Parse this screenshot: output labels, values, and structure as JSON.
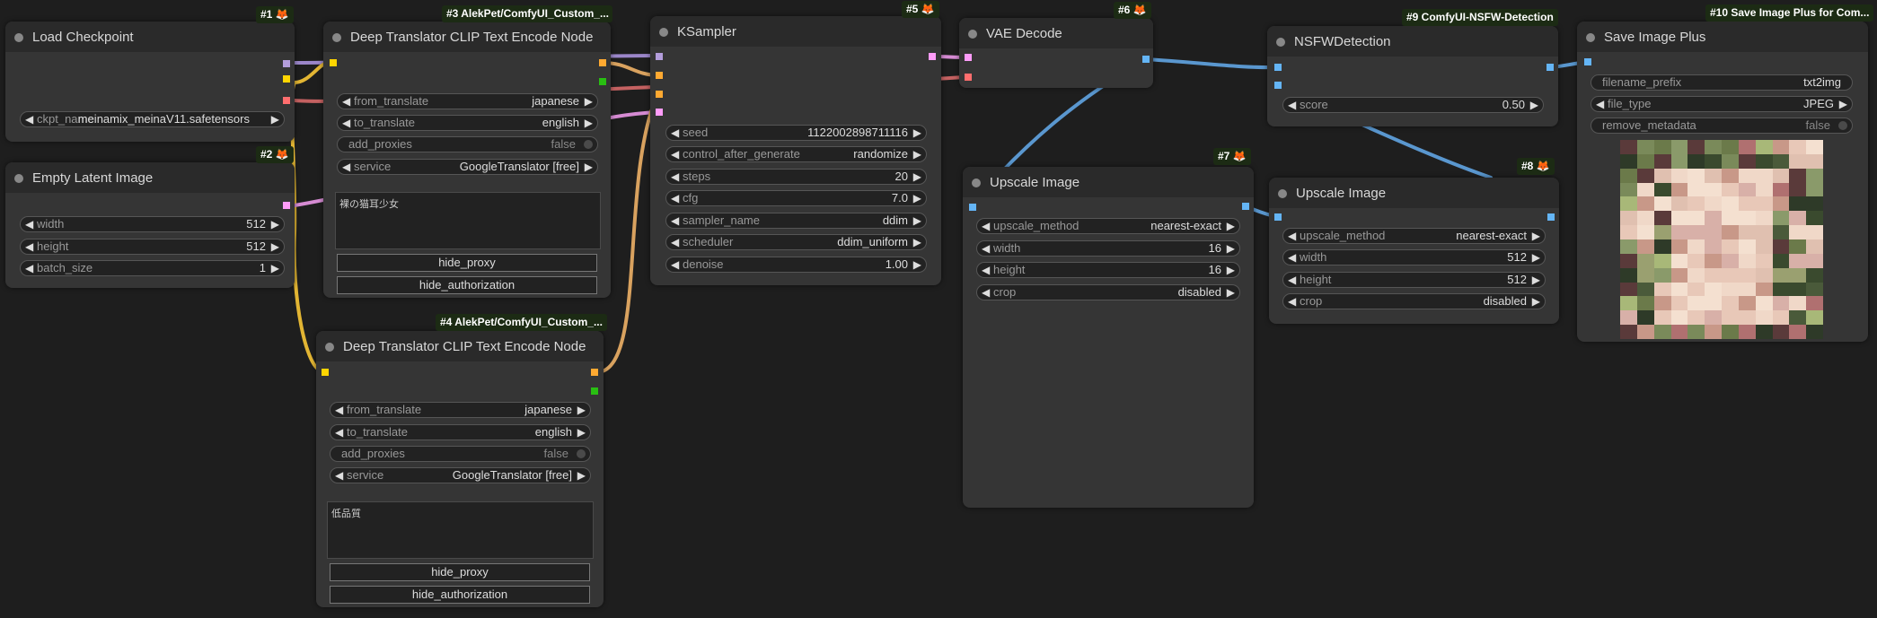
{
  "colors": {
    "clip": "#ffd500",
    "model": "#b39ddb",
    "vae": "#ff6e6e",
    "conditioning": "#ffa931",
    "latent": "#ff9cf9",
    "image": "#64b5f6",
    "int": "#29bf12",
    "link_model": "#9b86c9",
    "link_clip": "#e2b533",
    "link_vae": "#c46161",
    "link_cond": "#d9a25f",
    "link_latent": "#d68bd3",
    "link_image": "#5a97cf"
  },
  "icons": {
    "left": "◀",
    "right": "▶"
  },
  "nodes": {
    "load_checkpoint": {
      "badge": "#1",
      "title": "Load Checkpoint",
      "ckpt_name": {
        "label": "ckpt_name",
        "value": "meinamix_meinaV11.safetensors"
      }
    },
    "empty_latent": {
      "badge": "#2",
      "title": "Empty Latent Image",
      "width": {
        "label": "width",
        "value": "512"
      },
      "height": {
        "label": "height",
        "value": "512"
      },
      "batch_size": {
        "label": "batch_size",
        "value": "1"
      }
    },
    "translator_pos": {
      "badge": "#3 AlekPet/ComfyUI_Custom_...",
      "title": "Deep Translator CLIP Text Encode Node",
      "from_translate": {
        "label": "from_translate",
        "value": "japanese"
      },
      "to_translate": {
        "label": "to_translate",
        "value": "english"
      },
      "add_proxies": {
        "label": "add_proxies",
        "value": "false"
      },
      "service": {
        "label": "service",
        "value": "GoogleTranslator [free]"
      },
      "text": "裸の猫耳少女",
      "hide_proxy": "hide_proxy",
      "hide_authorization": "hide_authorization"
    },
    "translator_neg": {
      "badge": "#4 AlekPet/ComfyUI_Custom_...",
      "title": "Deep Translator CLIP Text Encode Node",
      "from_translate": {
        "label": "from_translate",
        "value": "japanese"
      },
      "to_translate": {
        "label": "to_translate",
        "value": "english"
      },
      "add_proxies": {
        "label": "add_proxies",
        "value": "false"
      },
      "service": {
        "label": "service",
        "value": "GoogleTranslator [free]"
      },
      "text": "低品質",
      "hide_proxy": "hide_proxy",
      "hide_authorization": "hide_authorization"
    },
    "ksampler": {
      "badge": "#5",
      "title": "KSampler",
      "seed": {
        "label": "seed",
        "value": "1122002898711116"
      },
      "control_after_generate": {
        "label": "control_after_generate",
        "value": "randomize"
      },
      "steps": {
        "label": "steps",
        "value": "20"
      },
      "cfg": {
        "label": "cfg",
        "value": "7.0"
      },
      "sampler_name": {
        "label": "sampler_name",
        "value": "ddim"
      },
      "scheduler": {
        "label": "scheduler",
        "value": "ddim_uniform"
      },
      "denoise": {
        "label": "denoise",
        "value": "1.00"
      }
    },
    "vae_decode": {
      "badge": "#6",
      "title": "VAE Decode"
    },
    "upscale_1": {
      "badge": "#7",
      "title": "Upscale Image",
      "upscale_method": {
        "label": "upscale_method",
        "value": "nearest-exact"
      },
      "width": {
        "label": "width",
        "value": "16"
      },
      "height": {
        "label": "height",
        "value": "16"
      },
      "crop": {
        "label": "crop",
        "value": "disabled"
      }
    },
    "upscale_2": {
      "badge": "#8",
      "title": "Upscale Image",
      "upscale_method": {
        "label": "upscale_method",
        "value": "nearest-exact"
      },
      "width": {
        "label": "width",
        "value": "512"
      },
      "height": {
        "label": "height",
        "value": "512"
      },
      "crop": {
        "label": "crop",
        "value": "disabled"
      }
    },
    "nsfw": {
      "badge": "#9 ComfyUI-NSFW-Detection",
      "title": "NSFWDetection",
      "score": {
        "label": "score",
        "value": "0.50"
      }
    },
    "save_image": {
      "badge": "#10 Save Image Plus for Com...",
      "title": "Save Image Plus",
      "filename_prefix": {
        "label": "filename_prefix",
        "value": "txt2img"
      },
      "file_type": {
        "label": "file_type",
        "value": "JPEG"
      },
      "remove_metadata": {
        "label": "remove_metadata",
        "value": "false"
      },
      "preview_palette": [
        "#4a5a3a",
        "#6b7a4a",
        "#3a4a2e",
        "#8a9a6a",
        "#e8c8b8",
        "#f0d8c8",
        "#c89888",
        "#5a3a3a",
        "#7a8a5a",
        "#a8b878",
        "#2e3a28",
        "#d8b0a8",
        "#f4e0d0",
        "#9aa070",
        "#b07070",
        "#e0c0b0"
      ]
    }
  }
}
